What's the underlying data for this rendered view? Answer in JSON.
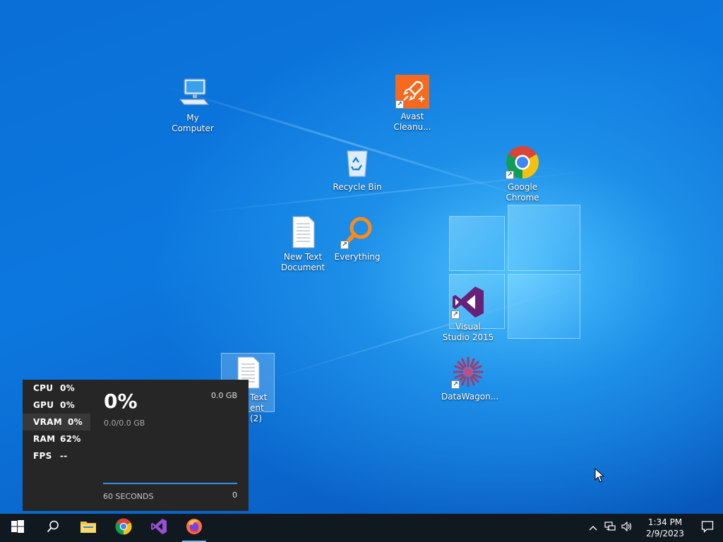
{
  "desktop": {
    "icons": {
      "my_computer": "My Computer",
      "avast": "Avast Cleanu...",
      "recycle_bin": "Recycle Bin",
      "chrome": "Google Chrome",
      "new_text_doc": "New Text Document",
      "everything": "Everything",
      "visual_studio": "Visual Studio 2015",
      "new_text_doc_2": "Text ent (2)",
      "datawagon": "DataWagon..."
    }
  },
  "perf_overlay": {
    "metrics": [
      {
        "key": "CPU",
        "value": "0%"
      },
      {
        "key": "GPU",
        "value": "0%"
      },
      {
        "key": "VRAM",
        "value": "0%"
      },
      {
        "key": "RAM",
        "value": "62%"
      },
      {
        "key": "FPS",
        "value": "--"
      }
    ],
    "big_value": "0%",
    "sub_value": "0.0/0.0 GB",
    "max_value": "0.0 GB",
    "time_window": "60 SECONDS",
    "graph_min": "0",
    "accent": "#3b8fe0"
  },
  "taskbar": {
    "apps": [
      "start-icon",
      "search-icon",
      "file-explorer-icon",
      "chrome-icon",
      "visual-studio-icon",
      "firefox-icon"
    ],
    "clock_time": "1:34 PM",
    "clock_date": "2/9/2023"
  }
}
